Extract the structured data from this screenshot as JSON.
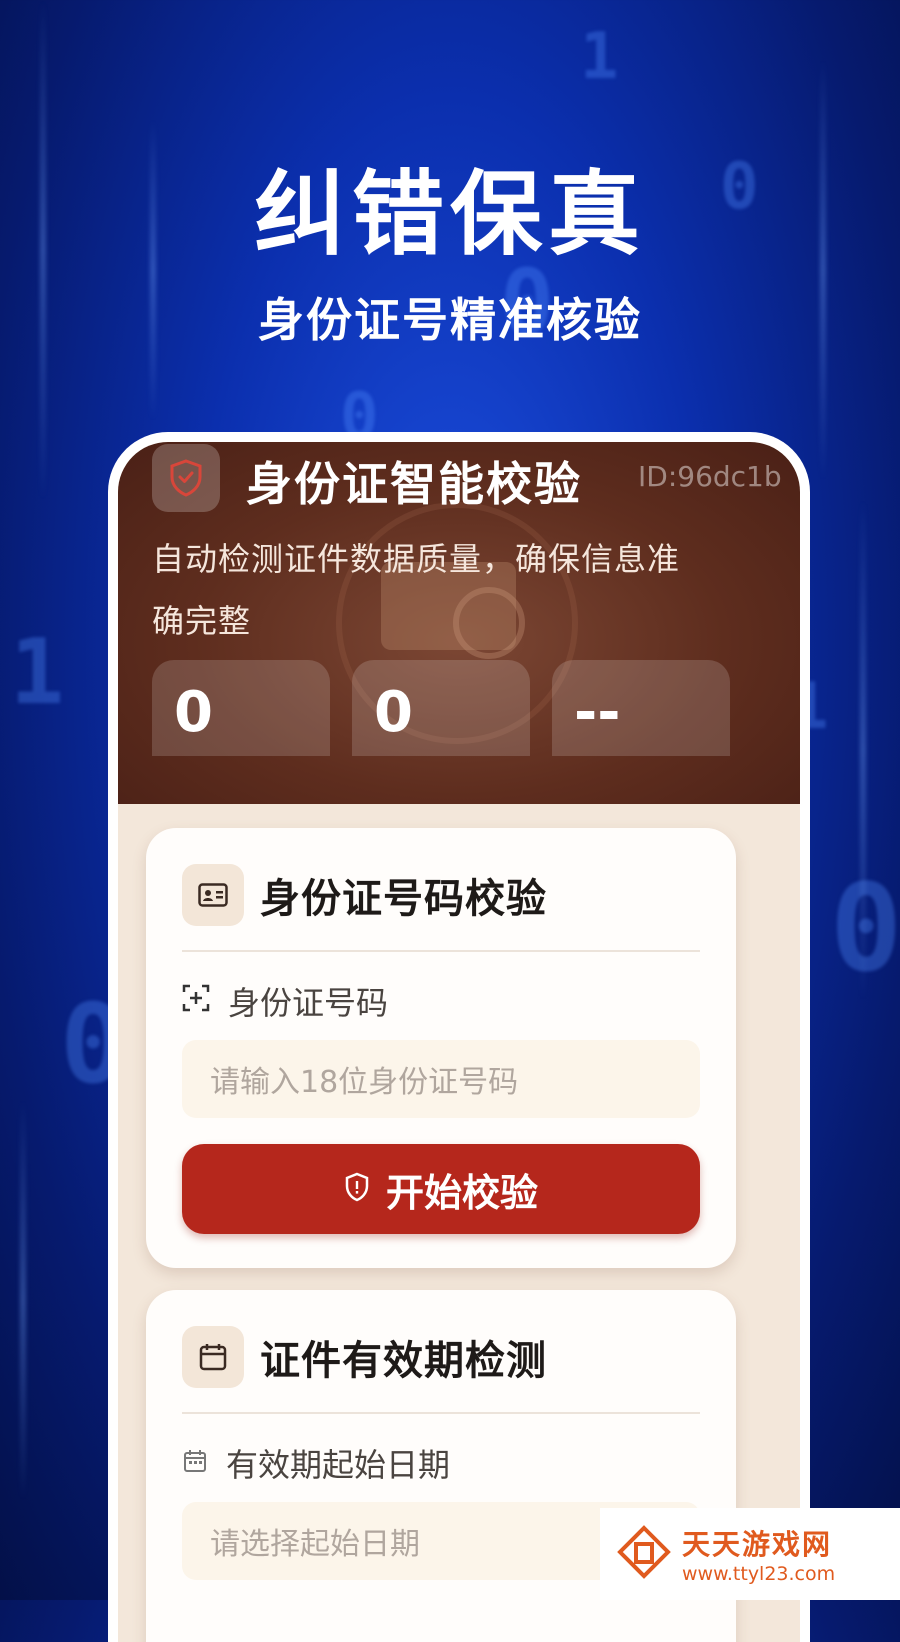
{
  "promo": {
    "title": "纠错保真",
    "subtitle": "身份证号精准核验"
  },
  "app": {
    "title": "身份证智能校验",
    "id_label": "ID:96dc1b",
    "description": "自动检测证件数据质量，确保信息准确完整",
    "stats": [
      {
        "value": "0"
      },
      {
        "value": "0"
      },
      {
        "value": "--"
      }
    ]
  },
  "id_check": {
    "title": "身份证号码校验",
    "field_label": "身份证号码",
    "placeholder": "请输入18位身份证号码",
    "button_label": "开始校验"
  },
  "expiry_check": {
    "title": "证件有效期检测",
    "field_label": "有效期起始日期",
    "placeholder": "请选择起始日期"
  },
  "watermark": {
    "name": "天天游戏网",
    "url": "www.ttyl23.com"
  },
  "colors": {
    "background": "#0b2fae",
    "hero": "#5e2d1e",
    "primary_button": "#b5271c",
    "card_bg": "#fffdfb",
    "phone_bg": "#f3e7da"
  },
  "icons": [
    "shield-logo-icon",
    "id-card-icon",
    "scan-icon",
    "shield-icon",
    "calendar-icon",
    "calendar-small-icon",
    "watermark-logo-icon"
  ]
}
